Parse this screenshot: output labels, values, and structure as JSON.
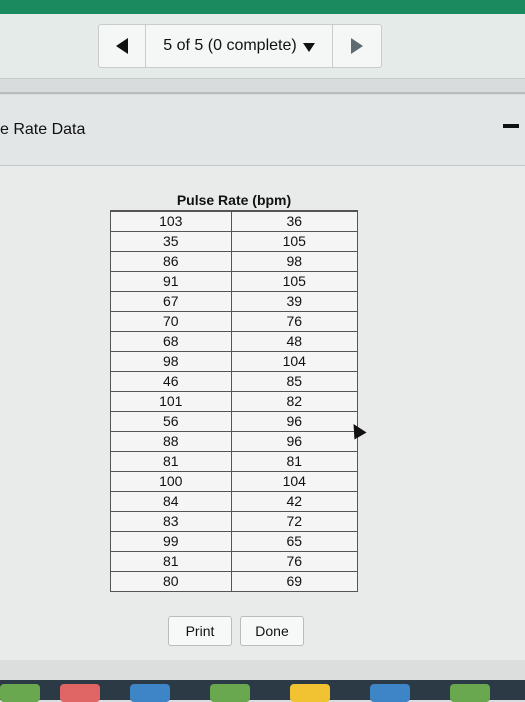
{
  "toolbar": {
    "position_text": "5 of 5 (0 complete)"
  },
  "header": {
    "title": "e Rate Data"
  },
  "table": {
    "header": "Pulse Rate (bpm)",
    "rows": [
      [
        "103",
        "36"
      ],
      [
        "35",
        "105"
      ],
      [
        "86",
        "98"
      ],
      [
        "91",
        "105"
      ],
      [
        "67",
        "39"
      ],
      [
        "70",
        "76"
      ],
      [
        "68",
        "48"
      ],
      [
        "98",
        "104"
      ],
      [
        "46",
        "85"
      ],
      [
        "101",
        "82"
      ],
      [
        "56",
        "96"
      ],
      [
        "88",
        "96"
      ],
      [
        "81",
        "81"
      ],
      [
        "100",
        "104"
      ],
      [
        "84",
        "42"
      ],
      [
        "83",
        "72"
      ],
      [
        "99",
        "65"
      ],
      [
        "81",
        "76"
      ],
      [
        "80",
        "69"
      ]
    ]
  },
  "buttons": {
    "print": "Print",
    "done": "Done"
  },
  "icons": {
    "prev": "left-triangle-icon",
    "dropdown": "caret-down-icon",
    "next": "right-triangle-icon",
    "minimize": "minimize-icon"
  },
  "colors": {
    "accent": "#1b8a5e",
    "dock": "#2c3a46"
  }
}
